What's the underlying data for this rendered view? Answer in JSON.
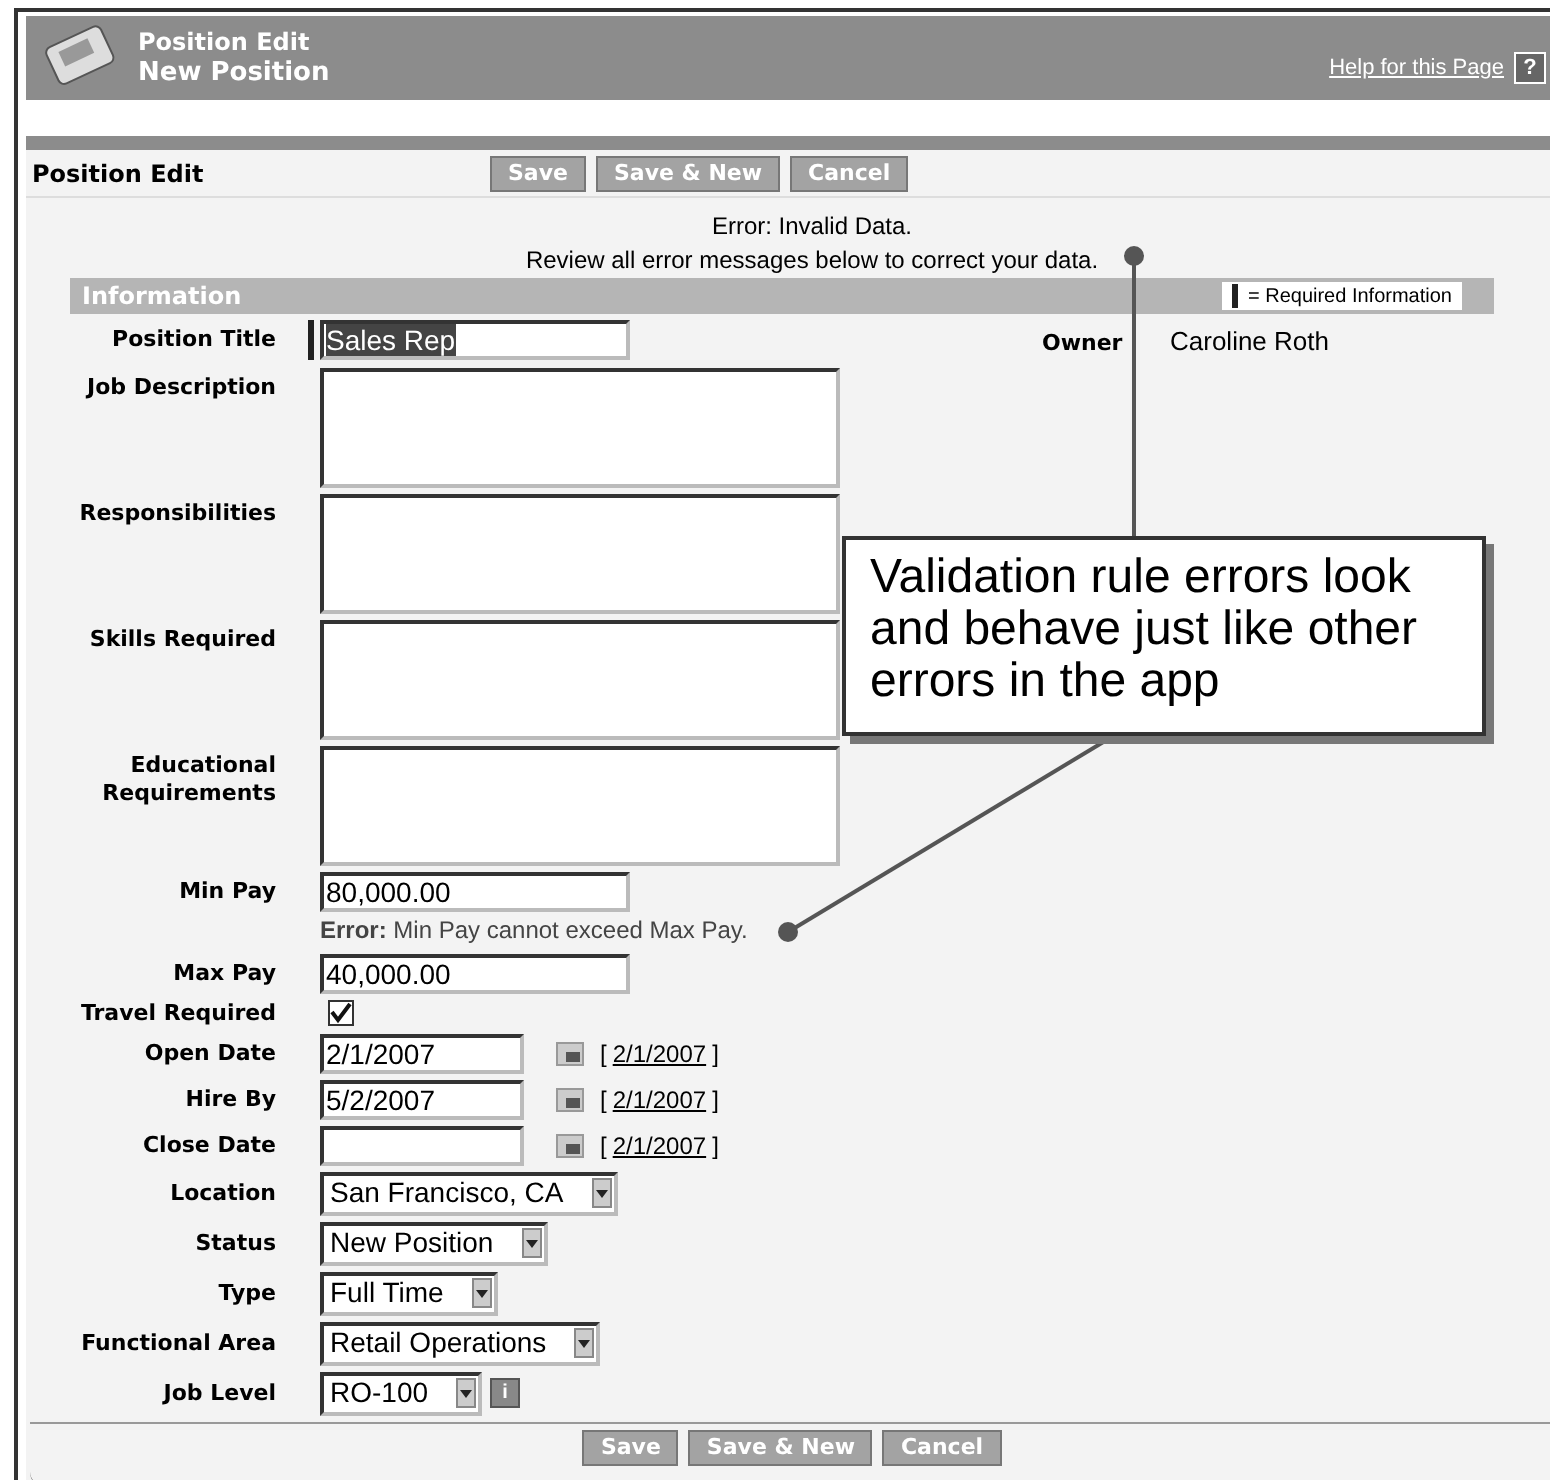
{
  "header": {
    "title": "Position Edit",
    "subtitle": "New Position",
    "help_link": "Help for this Page",
    "help_icon": "?"
  },
  "edit_bar": {
    "title": "Position Edit",
    "buttons": [
      "Save",
      "Save & New",
      "Cancel"
    ]
  },
  "page_error": {
    "line_1": "Error: Invalid Data.",
    "line_2": "Review all error messages below to correct your data."
  },
  "section": {
    "title": "Information",
    "legend": "= Required Information"
  },
  "owner": {
    "label": "Owner",
    "value": "Caroline Roth"
  },
  "fields": [
    {
      "kind": "text",
      "label": "Position Title",
      "value": "Sales Rep",
      "required": true,
      "text_selected": true
    },
    {
      "kind": "textarea",
      "label": "Job Description"
    },
    {
      "kind": "textarea",
      "label": "Responsibilities"
    },
    {
      "kind": "textarea",
      "label": "Skills Required"
    },
    {
      "kind": "textarea",
      "label": "Educational Requirements"
    },
    {
      "kind": "text",
      "label": "Min Pay",
      "value": "80,000.00",
      "error": "**Error:** Min Pay cannot exceed Max Pay."
    },
    {
      "kind": "text",
      "label": "Max Pay",
      "value": "40,000.00"
    },
    {
      "kind": "checkbox",
      "label": "Travel Required",
      "checked": true
    },
    {
      "kind": "date",
      "label": "Open Date",
      "value": "2/1/2007",
      "bracket_open": "[",
      "today_link": "2/1/2007",
      "bracket_close": "]"
    },
    {
      "kind": "date",
      "label": "Hire By",
      "value": "5/2/2007",
      "bracket_open": "[",
      "today_link": "2/1/2007",
      "bracket_close": "]"
    },
    {
      "kind": "date",
      "label": "Close Date",
      "bracket_open": "[",
      "today_link": "2/1/2007",
      "bracket_close": "]"
    },
    {
      "kind": "select",
      "label": "Location",
      "value": "San Francisco, CA"
    },
    {
      "kind": "select",
      "label": "Status",
      "value": "New Position"
    },
    {
      "kind": "select",
      "label": "Type",
      "value": "Full Time"
    },
    {
      "kind": "select",
      "label": "Functional Area",
      "value": "Retail Operations"
    },
    {
      "kind": "select",
      "label": "Job Level",
      "value": "RO-100",
      "info_button": "i"
    }
  ],
  "bottom_buttons": [
    "Save",
    "Save & New",
    "Cancel"
  ],
  "callout": {
    "text": "Validation rule errors look and behave just like other errors in the app"
  }
}
